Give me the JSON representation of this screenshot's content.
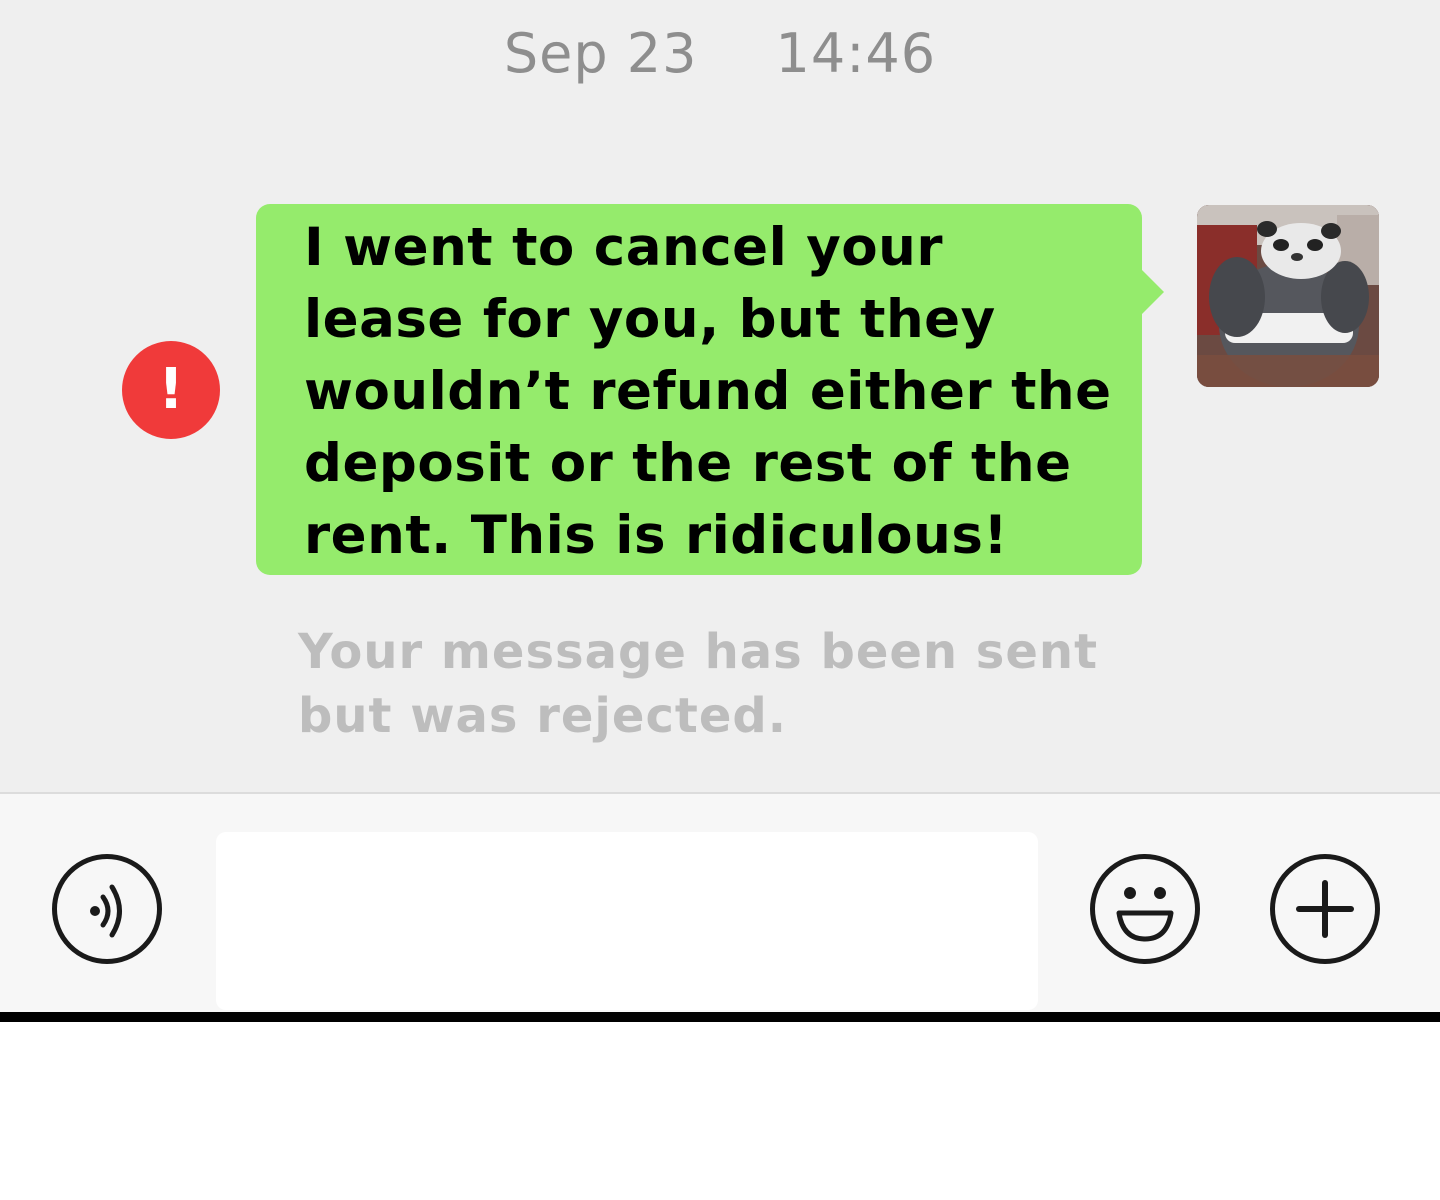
{
  "timestamp": {
    "date": "Sep 23",
    "time": "14:46"
  },
  "message": {
    "text": "I went to cancel your lease for you, but they wouldn’t refund either the deposit or the rest of the rent. This is ridiculous!",
    "status_icon": "exclamation-icon",
    "status_glyph": "!",
    "status_color": "#f03a3a",
    "bubble_color": "#95eb6c"
  },
  "status": {
    "text": "Your message has been sent but was rejected."
  },
  "avatar": {
    "icon": "panda-plush-avatar"
  },
  "input_bar": {
    "voice_icon": "voice-icon",
    "emoji_icon": "emoji-icon",
    "add_icon": "plus-icon",
    "input_value": ""
  }
}
